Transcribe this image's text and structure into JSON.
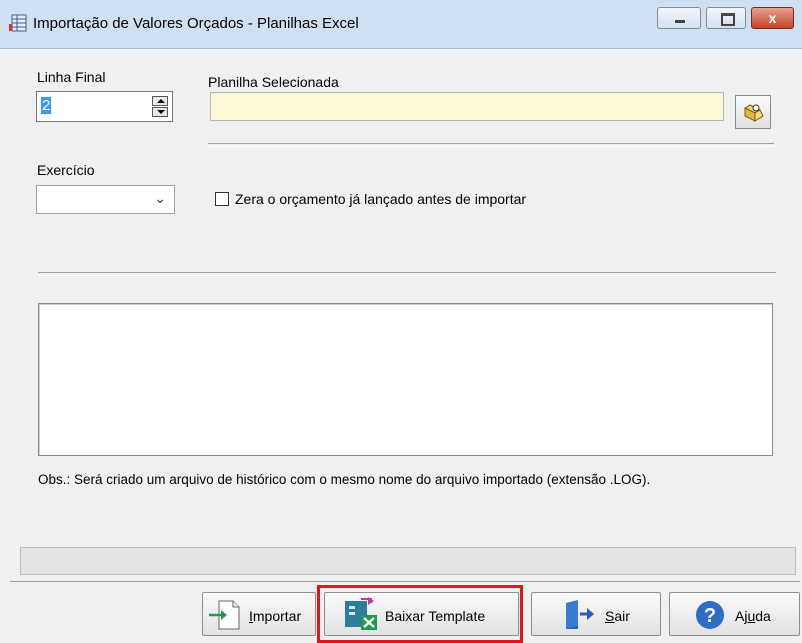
{
  "window": {
    "title": "Importação de Valores Orçados - Planilhas Excel",
    "controls": {
      "minimize": "minimize",
      "maximize": "maximize",
      "close": "x"
    }
  },
  "form": {
    "linha_final": {
      "label": "Linha Final",
      "value": "2"
    },
    "planilha": {
      "label": "Planilha Selecionada",
      "value": "",
      "background": "#fcf8d4"
    },
    "exercicio": {
      "label": "Exercício",
      "value": ""
    },
    "zera_checkbox": {
      "label": "Zera o orçamento já lançado antes de importar",
      "checked": false
    }
  },
  "log": {
    "content": ""
  },
  "obs": "Obs.: Será criado um arquivo de histórico com o mesmo nome do arquivo importado (extensão .LOG).",
  "buttons": {
    "importar": {
      "label_first": "I",
      "label_rest": "mportar",
      "icon": "import-arrow-icon"
    },
    "baixar_template": {
      "label": "Baixar Template",
      "icon": "excel-template-icon",
      "highlight_color": "#e0151d"
    },
    "sair": {
      "label_first": "S",
      "label_rest": "air",
      "icon": "exit-door-icon"
    },
    "ajuda": {
      "label_pre": "Aj",
      "label_u": "u",
      "label_post": "da",
      "icon": "help-icon"
    }
  }
}
